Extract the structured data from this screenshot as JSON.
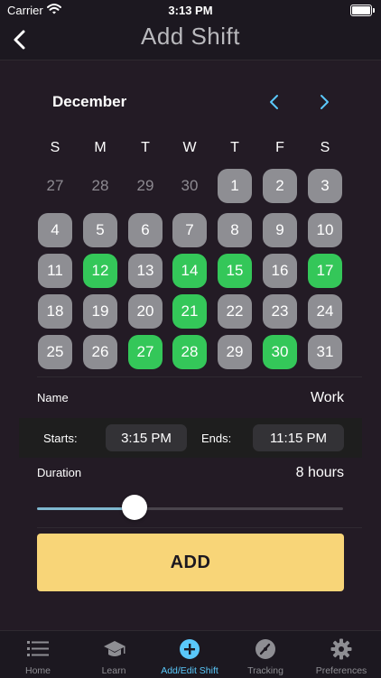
{
  "status": {
    "carrier": "Carrier",
    "time": "3:13 PM"
  },
  "nav": {
    "title": "Add Shift"
  },
  "calendar": {
    "month": "December",
    "weekdays": [
      "S",
      "M",
      "T",
      "W",
      "T",
      "F",
      "S"
    ],
    "rows": [
      [
        {
          "d": "27",
          "s": "out"
        },
        {
          "d": "28",
          "s": "out"
        },
        {
          "d": "29",
          "s": "out"
        },
        {
          "d": "30",
          "s": "out"
        },
        {
          "d": "1",
          "s": "off"
        },
        {
          "d": "2",
          "s": "off"
        },
        {
          "d": "3",
          "s": "off"
        }
      ],
      [
        {
          "d": "4",
          "s": "off"
        },
        {
          "d": "5",
          "s": "off"
        },
        {
          "d": "6",
          "s": "off"
        },
        {
          "d": "7",
          "s": "off"
        },
        {
          "d": "8",
          "s": "off"
        },
        {
          "d": "9",
          "s": "off"
        },
        {
          "d": "10",
          "s": "off"
        }
      ],
      [
        {
          "d": "11",
          "s": "off"
        },
        {
          "d": "12",
          "s": "on"
        },
        {
          "d": "13",
          "s": "off"
        },
        {
          "d": "14",
          "s": "on"
        },
        {
          "d": "15",
          "s": "on"
        },
        {
          "d": "16",
          "s": "off"
        },
        {
          "d": "17",
          "s": "on"
        }
      ],
      [
        {
          "d": "18",
          "s": "off"
        },
        {
          "d": "19",
          "s": "off"
        },
        {
          "d": "20",
          "s": "off"
        },
        {
          "d": "21",
          "s": "on"
        },
        {
          "d": "22",
          "s": "off"
        },
        {
          "d": "23",
          "s": "off"
        },
        {
          "d": "24",
          "s": "off"
        }
      ],
      [
        {
          "d": "25",
          "s": "off"
        },
        {
          "d": "26",
          "s": "off"
        },
        {
          "d": "27",
          "s": "on"
        },
        {
          "d": "28",
          "s": "on"
        },
        {
          "d": "29",
          "s": "off"
        },
        {
          "d": "30",
          "s": "on"
        },
        {
          "d": "31",
          "s": "off"
        }
      ]
    ]
  },
  "form": {
    "name_label": "Name",
    "name_value": "Work",
    "starts_label": "Starts:",
    "starts_value": "3:15 PM",
    "ends_label": "Ends:",
    "ends_value": "11:15 PM",
    "duration_label": "Duration",
    "duration_value": "8 hours",
    "slider_fraction": 0.32,
    "add_label": "ADD"
  },
  "tabs": [
    {
      "label": "Home",
      "icon": "list-icon"
    },
    {
      "label": "Learn",
      "icon": "graduation-cap-icon"
    },
    {
      "label": "Add/Edit Shift",
      "icon": "plus-circle-icon"
    },
    {
      "label": "Tracking",
      "icon": "gauge-icon"
    },
    {
      "label": "Preferences",
      "icon": "gear-icon"
    }
  ],
  "colors": {
    "background": "#231b25",
    "accent_blue": "#5ac8fa",
    "shift_green": "#34c759",
    "day_gray": "#8e8e93",
    "add_button": "#f8d578"
  }
}
